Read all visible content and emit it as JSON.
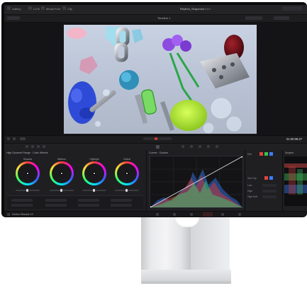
{
  "menu": {
    "items": [
      "Gallery",
      "LUTs",
      "Media Pool",
      "Clip"
    ],
    "project_title": "Rhythm_Sequence",
    "project_status": "Edited"
  },
  "viewer": {
    "timeline_name": "Timeline 1",
    "timecode": "01:00:08:27"
  },
  "color_wheels": {
    "title": "High Dynamic Range · Color Wheels",
    "wheels": [
      {
        "name": "Shadow"
      },
      {
        "name": "Midtone"
      },
      {
        "name": "Highlight"
      },
      {
        "name": "Global"
      }
    ]
  },
  "curves": {
    "title": "Curves · Custom"
  },
  "side_panel": {
    "labels": [
      "Edit",
      "Soft Clip",
      "Low",
      "High",
      "High Soft"
    ]
  },
  "scopes": {
    "title": "Scopes"
  },
  "footer": {
    "device": "DaVinci Resolve 19"
  },
  "colors": {
    "accent_red": "#e0433b",
    "accent_blue": "#3c7cff"
  }
}
